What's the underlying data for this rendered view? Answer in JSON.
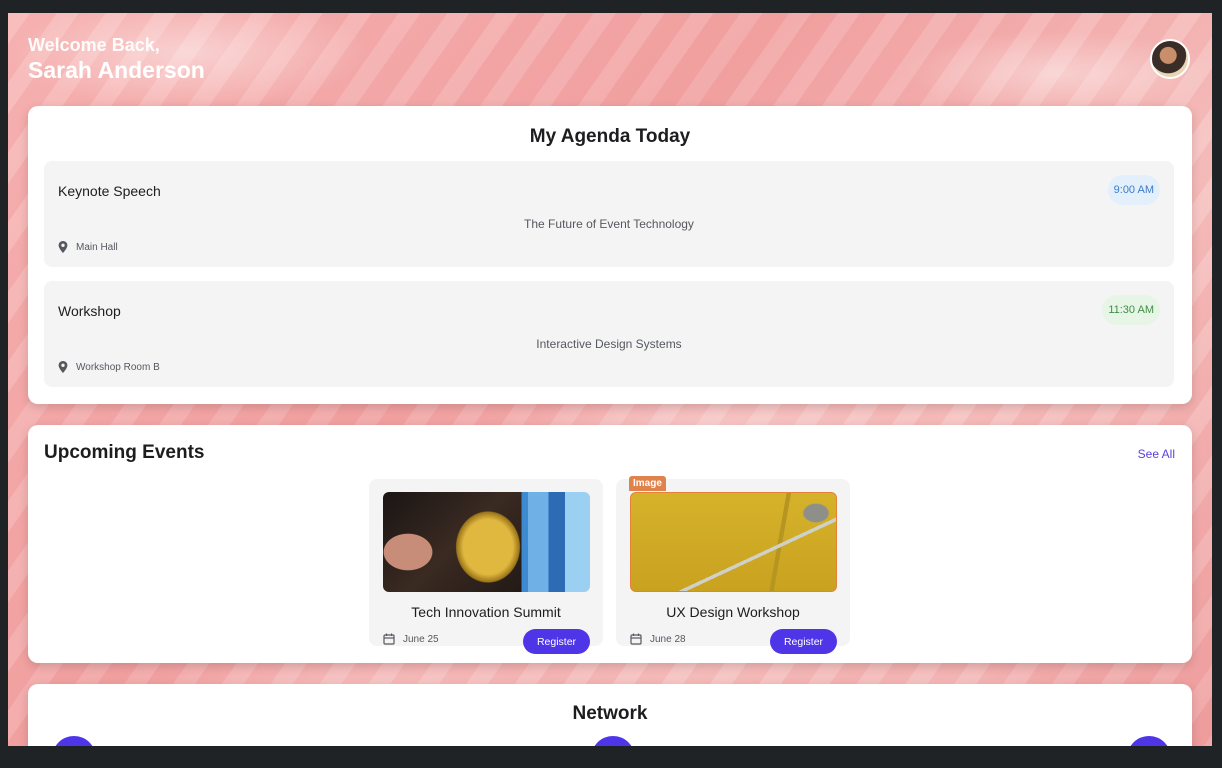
{
  "header": {
    "greeting": "Welcome Back,",
    "user_name": "Sarah Anderson"
  },
  "agenda": {
    "title": "My Agenda Today",
    "items": [
      {
        "title": "Keynote Speech",
        "time": "9:00 AM",
        "description": "The Future of Event Technology",
        "location": "Main Hall",
        "time_bg": "#e3f0fc",
        "time_color": "#3b7bc8"
      },
      {
        "title": "Workshop",
        "time": "11:30 AM",
        "description": "Interactive Design Systems",
        "location": "Workshop Room B",
        "time_bg": "#e6f5e6",
        "time_color": "#3f8f45"
      }
    ]
  },
  "upcoming": {
    "title": "Upcoming Events",
    "see_all": "See All",
    "events": [
      {
        "title": "Tech Innovation Summit",
        "date": "June 25",
        "button": "Register"
      },
      {
        "title": "UX Design Workshop",
        "date": "June 28",
        "button": "Register",
        "tag": "Image"
      }
    ]
  },
  "network": {
    "title": "Network"
  },
  "colors": {
    "accent": "#4f35e8",
    "link": "#5b3fe0",
    "tag": "#e0824b"
  }
}
